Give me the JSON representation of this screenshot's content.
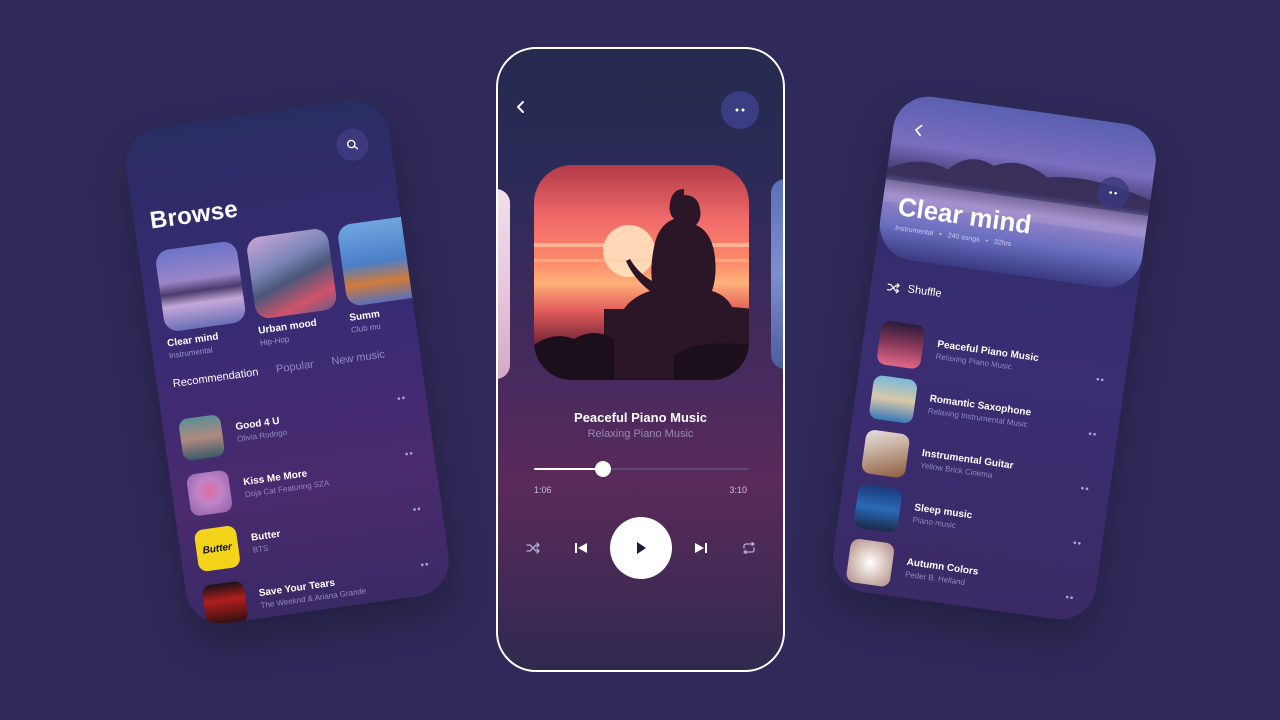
{
  "browse": {
    "title": "Browse",
    "icons": {
      "search": "search-icon"
    },
    "featured": [
      {
        "name": "Clear mind",
        "sub": "Instrumental"
      },
      {
        "name": "Urban mood",
        "sub": "Hip-Hop"
      },
      {
        "name": "Summ",
        "sub": "Club mu"
      }
    ],
    "tabs": [
      "Recommendation",
      "Popular",
      "New music"
    ],
    "tracks": [
      {
        "title": "Good 4 U",
        "artist": "Olivia Rodrigo"
      },
      {
        "title": "Kiss Me More",
        "artist": "Doja Cat Featuring SZA"
      },
      {
        "title": "Butter",
        "artist": "BTS",
        "thumb_text": "Butter"
      },
      {
        "title": "Save Your Tears",
        "artist": "The Weeknd & Ariana Grande"
      }
    ]
  },
  "player": {
    "icons": {
      "back": "chevron-left-icon",
      "more": "more-icon"
    },
    "track_title": "Peaceful Piano Music",
    "track_subtitle": "Relaxing Piano Music",
    "time_elapsed": "1:06",
    "time_total": "3:10",
    "progress": 0.32,
    "controls": [
      "shuffle-icon",
      "previous-icon",
      "play-icon",
      "next-icon",
      "repeat-icon"
    ]
  },
  "playlist": {
    "title": "Clear mind",
    "meta": [
      "Instrumental",
      "240 songs",
      "32hrs"
    ],
    "shuffle_label": "Shuffle",
    "tracks": [
      {
        "title": "Peaceful Piano Music",
        "artist": "Relaxing Piano Music"
      },
      {
        "title": "Romantic Saxophone",
        "artist": "Relaxing Instrumental Music"
      },
      {
        "title": "Instrumental Guitar",
        "artist": "Yellow Brick Cinema"
      },
      {
        "title": "Sleep music",
        "artist": "Piano music"
      },
      {
        "title": "Autumn Colors",
        "artist": "Peder B. Helland"
      }
    ]
  },
  "colors": {
    "background": "#2f2a59",
    "accent": "#3b3a7e",
    "muted_text": "#8f8ac0"
  }
}
